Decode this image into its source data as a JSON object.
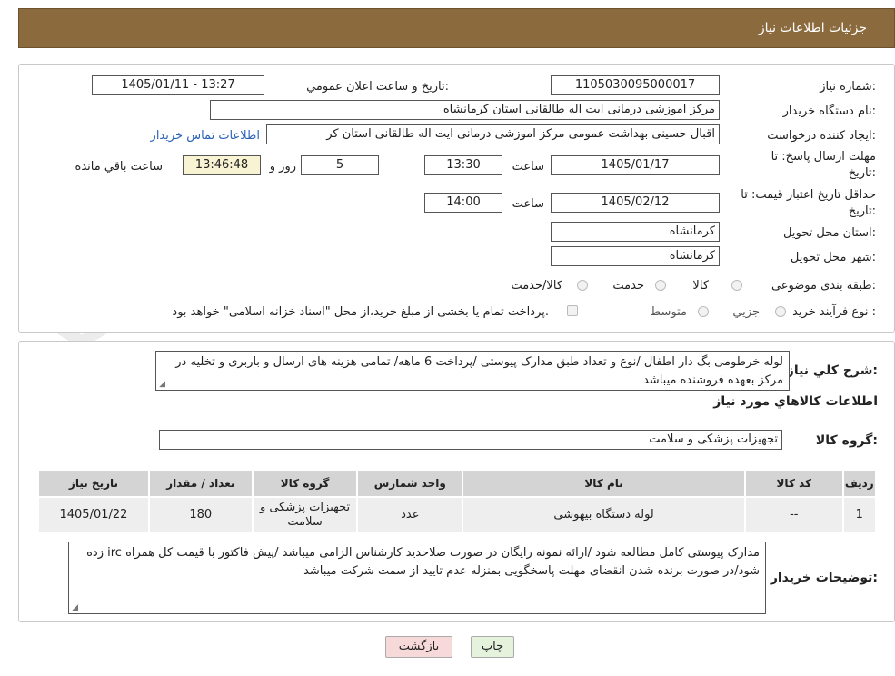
{
  "header": {
    "title": "جزئیات اطلاعات نیاز"
  },
  "watermark": {
    "text": "AriaTender.neT"
  },
  "form": {
    "need_number": {
      "label": "شماره نیاز:",
      "value": "1105030095000017"
    },
    "announce_datetime": {
      "label": "تاریخ و ساعت اعلان عمومي:",
      "value": "1405/01/11 - 13:27"
    },
    "buyer_org": {
      "label": "نام دستگاه خريدار:",
      "value": "مرکز اموزشی درمانی ایت اله طالقانی استان کرمانشاه"
    },
    "requester": {
      "label": "ايجاد کننده درخواست:",
      "value": "اقبال حسینی بهداشت عمومی مرکز اموزشی درمانی ایت اله طالقانی استان کر",
      "link": "اطلاعات تماس خريدار"
    },
    "reply_deadline": {
      "label": "مهلت ارسال پاسخ: تا",
      "label2": "تاريخ:",
      "date": "1405/01/17",
      "time_label": "ساعت",
      "time": "13:30",
      "days": "5",
      "days_label": "روز و",
      "remaining": "13:46:48",
      "remaining_label": "ساعت باقي مانده"
    },
    "price_validity": {
      "label": "حداقل تاريخ اعتبار قيمت: تا",
      "label2": "تاريخ:",
      "date": "1405/02/12",
      "time_label": "ساعت",
      "time": "14:00"
    },
    "delivery_province": {
      "label": "استان محل تحويل:",
      "value": "کرمانشاه"
    },
    "delivery_city": {
      "label": "شهر محل تحويل:",
      "value": "کرمانشاه"
    },
    "category": {
      "label": "طبقه بندی موضوعی:",
      "options": [
        "کالا",
        "خدمت",
        "کالا/خدمت"
      ]
    },
    "purchase_type": {
      "label": "نوع فرآيند خريد :",
      "options": [
        "جزيي",
        "متوسط"
      ],
      "note": "پرداخت تمام يا بخشی از مبلغ خريد،از محل \"اسناد خزانه اسلامی\" خواهد بود."
    }
  },
  "description": {
    "label": "شرح کلي نياز:",
    "text": "لوله خرطومی بگ دار اطفال /نوع و تعداد طبق مدارک پیوستی /پرداخت 6 ماهه/ تمامی هزینه های ارسال و باربری و تخلیه در مرکز بعهده فروشنده میباشد"
  },
  "goods": {
    "section_title": "اطلاعات کالاهاي مورد نياز",
    "group_label": "گروه کالا:",
    "group_value": "تجهیزات پزشکی و سلامت",
    "columns": [
      "رديف",
      "کد کالا",
      "نام کالا",
      "واحد شمارش",
      "گروه کالا",
      "تعداد / مقدار",
      "تاريخ نياز"
    ],
    "rows": [
      [
        "1",
        "--",
        "لوله دستگاه بیهوشی",
        "عدد",
        "تجهیزات پزشکی و سلامت",
        "180",
        "1405/01/22"
      ]
    ]
  },
  "buyer_notes": {
    "label": "توضيحات خريدار:",
    "text": "مدارک پیوستی کامل مطالعه شود /ارائه نمونه رایگان در صورت صلاحدید کارشناس الزامی میباشد /پیش فاکتور با قیمت کل همراه irc  زده شود/در صورت برنده شدن انقضای مهلت پاسخگویی بمنزله عدم تایید از سمت شرکت میباشد"
  },
  "buttons": {
    "print": "چاپ",
    "back": "بازگشت"
  },
  "colors": {
    "header_bg": "#8b6a3e",
    "link": "#2a63b8",
    "back_button_bg": "#f7d9d9",
    "print_button_bg": "#e5f3dc"
  }
}
